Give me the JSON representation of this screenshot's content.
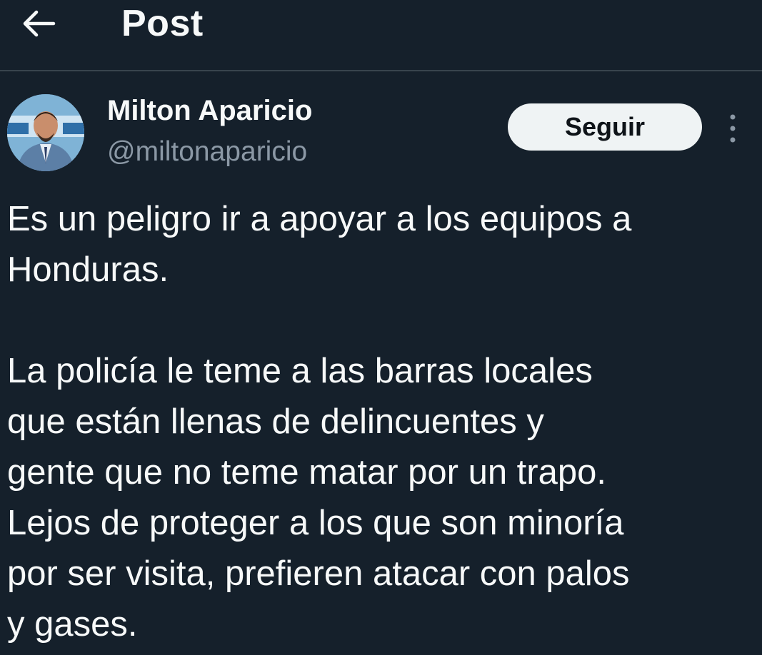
{
  "header": {
    "back_icon": "arrow-left-icon",
    "title": "Post"
  },
  "author": {
    "name": "Milton Aparicio",
    "handle": "@miltonaparicio",
    "avatar_icon": "profile-photo"
  },
  "actions": {
    "follow_label": "Seguir",
    "more_icon": "more-vertical-icon"
  },
  "tweet": {
    "paragraph_1": "Es un peligro ir a apoyar a los equipos a\nHonduras.",
    "paragraph_2": "La policía le teme a las barras locales\nque están llenas de delincuentes y\ngente que no teme matar por un trapo.\nLejos de proteger a los que son minoría\npor ser visita, prefieren atacar con palos\ny gases."
  },
  "colors": {
    "background": "#15202b",
    "text": "#f7f9f9",
    "secondary_text": "#8b98a5",
    "divider": "#38444d",
    "button_bg": "#eff3f4",
    "button_text": "#0f1419"
  }
}
